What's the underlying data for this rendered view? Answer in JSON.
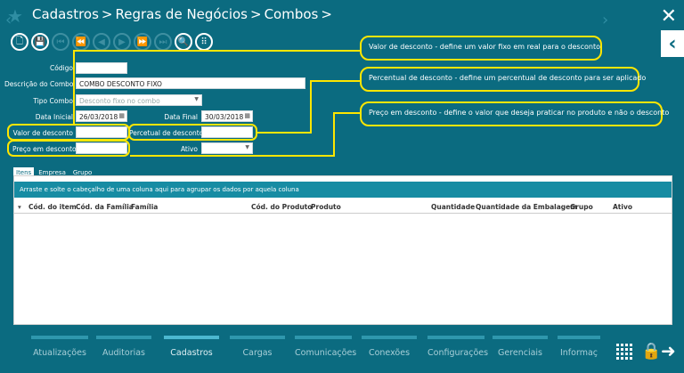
{
  "breadcrumb": [
    "Cadastros",
    "Regras de Negócios",
    "Combos"
  ],
  "toolbar": {
    "buttons": [
      {
        "name": "new-icon",
        "glyph": "🗋",
        "disabled": false
      },
      {
        "name": "save-icon",
        "glyph": "💾",
        "disabled": false
      },
      {
        "name": "first-record-icon",
        "glyph": "⏮",
        "disabled": true
      },
      {
        "name": "previous-page-icon",
        "glyph": "⏪",
        "disabled": true
      },
      {
        "name": "previous-record-icon",
        "glyph": "◀",
        "disabled": true
      },
      {
        "name": "next-record-icon",
        "glyph": "▶",
        "disabled": true
      },
      {
        "name": "next-page-icon",
        "glyph": "⏩",
        "disabled": true
      },
      {
        "name": "last-record-icon",
        "glyph": "⏭",
        "disabled": true
      },
      {
        "name": "search-icon",
        "glyph": "🔍",
        "disabled": false
      },
      {
        "name": "grid-view-icon",
        "glyph": "⠿",
        "disabled": false
      }
    ]
  },
  "form": {
    "codigo_label": "Código",
    "codigo_value": "",
    "descricao_label": "Descrição do Combo",
    "descricao_value": "COMBO DESCONTO FIXO",
    "tipo_label": "Tipo Combo",
    "tipo_value": "Desconto fixo no combo",
    "data_inicial_label": "Data Inicial",
    "data_inicial_value": "26/03/2018",
    "data_final_label": "Data Final",
    "data_final_value": "30/03/2018",
    "valor_label": "Valor de desconto",
    "valor_value": "",
    "percentual_label": "Percetual de desconto",
    "percentual_value": "",
    "preco_label": "Preço em desconto",
    "preco_value": "",
    "ativo_label": "Ativo",
    "ativo_value": ""
  },
  "callouts": {
    "valor": "Valor de desconto - define um valor fixo em real para o desconto",
    "percentual": "Percentual de desconto - define um percentual de desconto para ser aplicado",
    "preco": "Preço em desconto - define o valor que deseja praticar no produto e não o desconto"
  },
  "tabs": [
    "Itens",
    "Empresa",
    "Grupo"
  ],
  "grid": {
    "group_hint": "Arraste e solte o cabeçalho de uma coluna aqui para agrupar os dados por aquela coluna",
    "columns": [
      "Cód. do item",
      "Cód. da Família",
      "Família",
      "Cód. do Produto",
      "Produto",
      "Quantidade",
      "Quantidade da Embalagem",
      "Grupo",
      "Ativo"
    ]
  },
  "bottom_nav": [
    {
      "label": "Atualizações",
      "active": false
    },
    {
      "label": "Auditorias",
      "active": false
    },
    {
      "label": "Cadastros",
      "active": true
    },
    {
      "label": "Cargas",
      "active": false
    },
    {
      "label": "Comunicações",
      "active": false
    },
    {
      "label": "Conexões",
      "active": false
    },
    {
      "label": "Configurações",
      "active": false
    },
    {
      "label": "Gerenciais",
      "active": false
    },
    {
      "label": "Informaç",
      "active": false
    }
  ],
  "colors": {
    "background": "#0b6b80",
    "highlight": "#ffe600",
    "group_bar": "#178ca3"
  }
}
